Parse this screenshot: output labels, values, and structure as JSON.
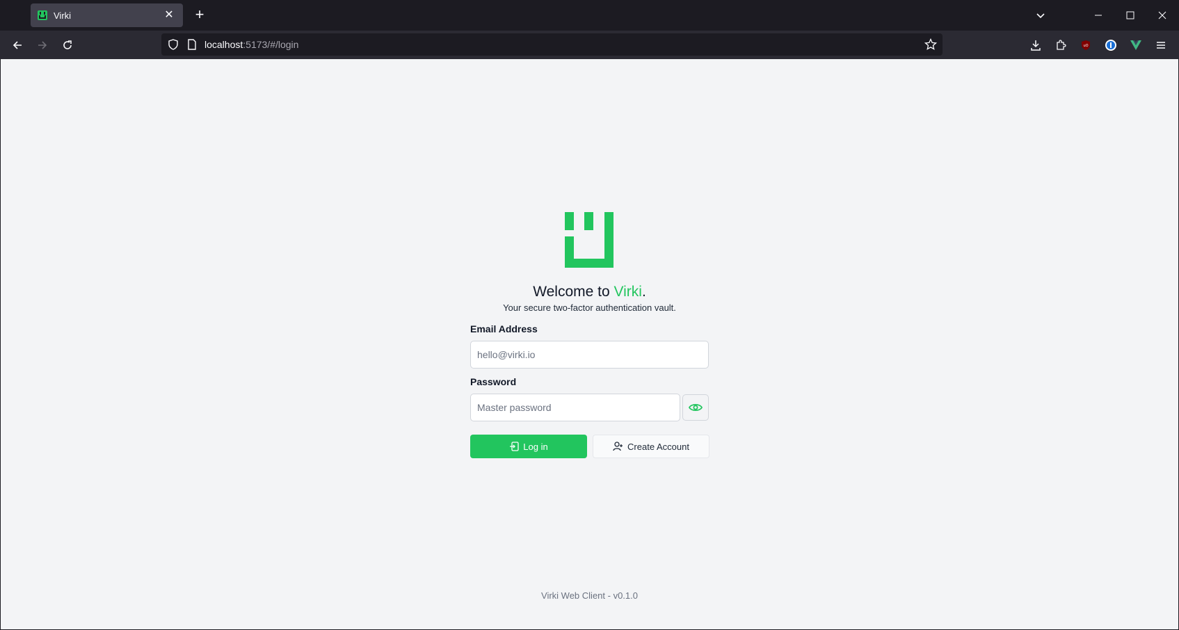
{
  "browser": {
    "tab_title": "Virki",
    "tab_close_icon": "close-icon",
    "new_tab_icon": "plus-icon",
    "url_host": "localhost",
    "url_rest": ":5173/#/login",
    "colors": {
      "chrome_dark": "#1c1b22",
      "chrome_mid": "#2b2a33",
      "tab_active": "#42414d"
    }
  },
  "login": {
    "welcome_prefix": "Welcome to ",
    "brand": "Virki",
    "welcome_suffix": ".",
    "tagline": "Your secure two-factor authentication vault.",
    "email_label": "Email Address",
    "email_placeholder": "hello@virki.io",
    "email_value": "",
    "password_label": "Password",
    "password_placeholder": "Master password",
    "password_value": "",
    "login_button": "Log in",
    "create_button": "Create Account",
    "footer": "Virki Web Client - v0.1.0",
    "colors": {
      "accent": "#22c55e",
      "page_bg": "#f3f4f6"
    }
  }
}
